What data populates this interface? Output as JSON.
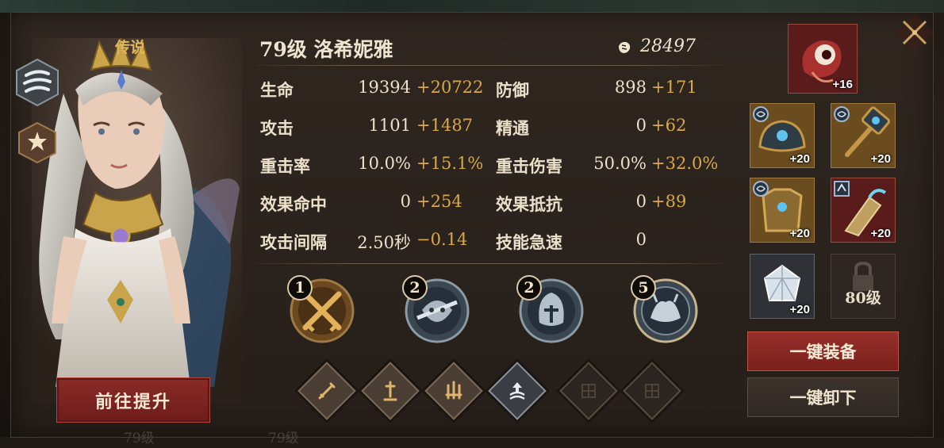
{
  "hero": {
    "rarity": "传说",
    "title": "79级 洛希妮雅",
    "power": "28497",
    "promote_label": "前往提升",
    "element_icon": "wind-icon",
    "class_icon": "star-emblem-icon"
  },
  "stats": [
    {
      "name": "生命",
      "value": "19394",
      "bonus": "+20722"
    },
    {
      "name": "防御",
      "value": "898",
      "bonus": "+171"
    },
    {
      "name": "攻击",
      "value": "1101",
      "bonus": "+1487"
    },
    {
      "name": "精通",
      "value": "0",
      "bonus": "+62"
    },
    {
      "name": "重击率",
      "value": "10.0%",
      "bonus": "+15.1%"
    },
    {
      "name": "重击伤害",
      "value": "50.0%",
      "bonus": "+32.0%"
    },
    {
      "name": "效果命中",
      "value": "0",
      "bonus": "+254"
    },
    {
      "name": "效果抵抗",
      "value": "0",
      "bonus": "+89"
    },
    {
      "name": "攻击间隔",
      "value": "2.50秒",
      "bonus": "−0.14"
    },
    {
      "name": "技能急速",
      "value": "0",
      "bonus": ""
    }
  ],
  "skills": [
    {
      "level": "1",
      "icon": "crossed-swords-icon"
    },
    {
      "level": "2",
      "icon": "masked-warrior-icon"
    },
    {
      "level": "2",
      "icon": "helmet-icon"
    },
    {
      "level": "5",
      "icon": "beast-emblem-icon"
    }
  ],
  "passives": [
    {
      "icon": "sword-icon",
      "active": true
    },
    {
      "icon": "planted-sword-icon",
      "active": true
    },
    {
      "icon": "triple-blade-icon",
      "active": true
    },
    {
      "icon": "upgrade-arrow-icon",
      "active": true
    },
    {
      "icon": "knot-pattern-icon",
      "active": false
    },
    {
      "icon": "knot-pattern-icon",
      "active": false
    }
  ],
  "equipment": {
    "artifact": {
      "plus": "+16",
      "icon": "eye-artifact-icon"
    },
    "slots": [
      {
        "plus": "+20",
        "icon": "helmet-gear-icon",
        "badge": "set-badge-icon"
      },
      {
        "plus": "+20",
        "icon": "hammer-weapon-icon",
        "badge": "set-badge-icon"
      },
      {
        "plus": "+20",
        "icon": "armor-gear-icon",
        "badge": "set-badge-icon"
      },
      {
        "plus": "+20",
        "icon": "gauntlet-gear-icon",
        "badge": "element-badge-icon"
      },
      {
        "plus": "+20",
        "icon": "crystal-gem-icon",
        "badge": ""
      }
    ],
    "locked_label": "80级",
    "equip_all_label": "一键装备",
    "unequip_all_label": "一键卸下"
  },
  "ghost": {
    "left": "79级",
    "mid": "79级"
  },
  "colors": {
    "accent_gold": "#d8a84a",
    "primary_red": "#8a2a26",
    "text": "#ece0ca"
  }
}
